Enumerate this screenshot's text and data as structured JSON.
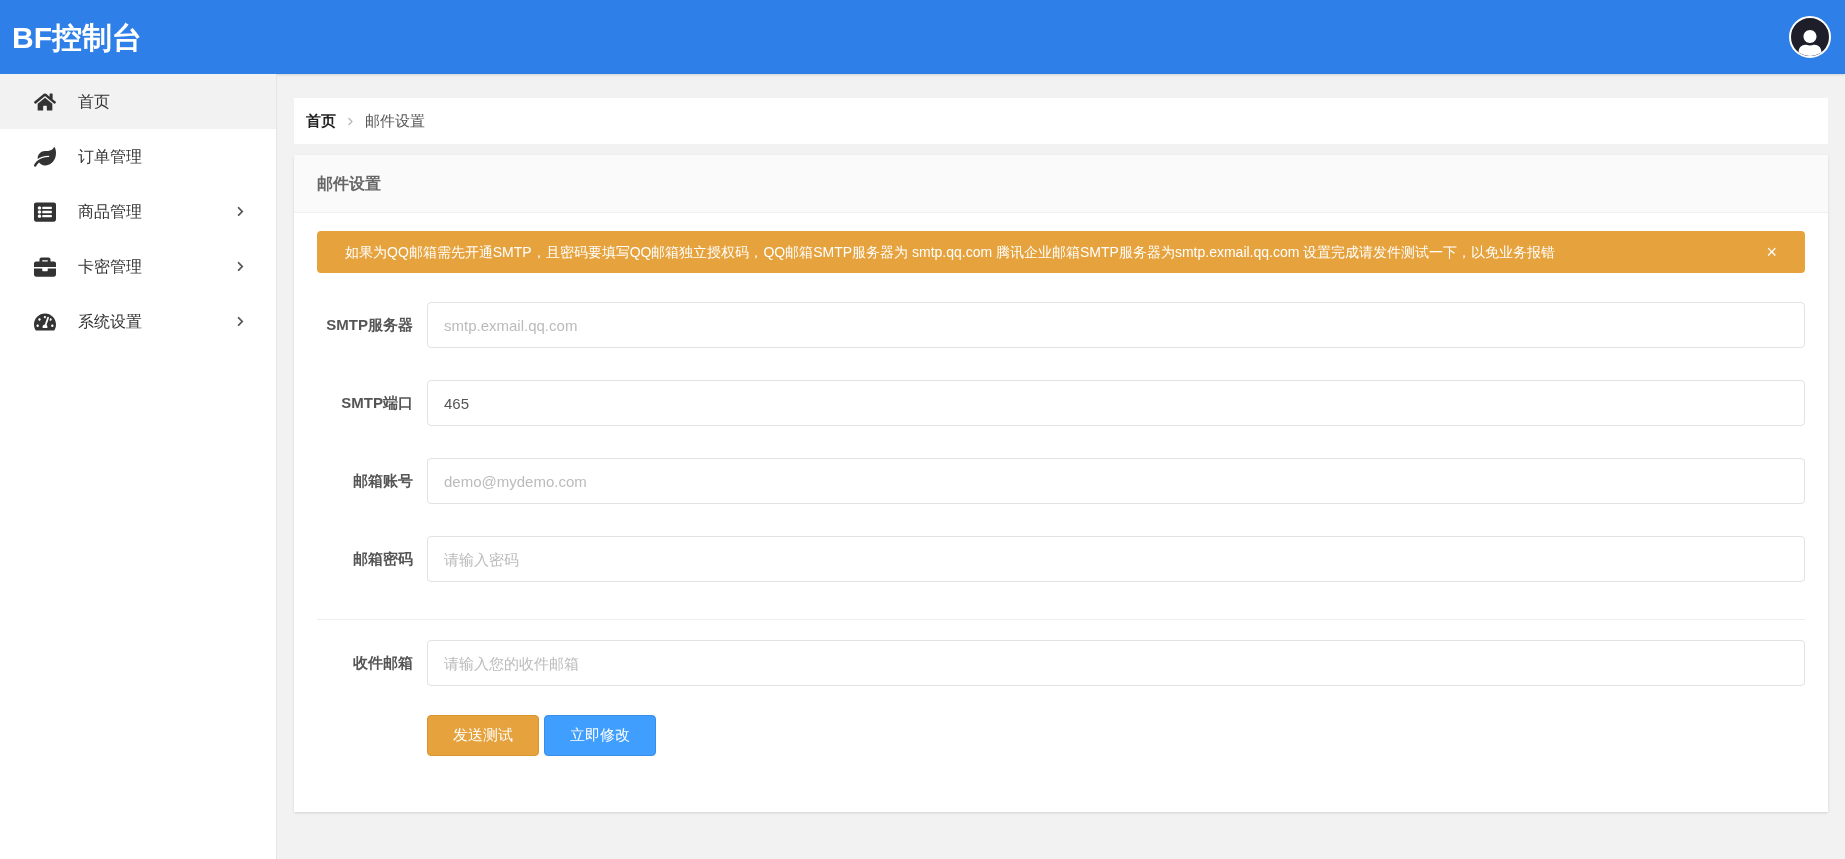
{
  "header": {
    "title": "BF控制台"
  },
  "sidebar": {
    "items": [
      {
        "label": "首页",
        "selected": true,
        "has_submenu": false
      },
      {
        "label": "订单管理",
        "selected": false,
        "has_submenu": false
      },
      {
        "label": "商品管理",
        "selected": false,
        "has_submenu": true
      },
      {
        "label": "卡密管理",
        "selected": false,
        "has_submenu": true
      },
      {
        "label": "系统设置",
        "selected": false,
        "has_submenu": true
      }
    ]
  },
  "breadcrumb": [
    "首页",
    "邮件设置"
  ],
  "card": {
    "title": "邮件设置",
    "alert": {
      "text": "如果为QQ邮箱需先开通SMTP，且密码要填写QQ邮箱独立授权码，QQ邮箱SMTP服务器为 smtp.qq.com 腾讯企业邮箱SMTP服务器为smtp.exmail.qq.com 设置完成请发件测试一下，以免业务报错",
      "close": "×"
    },
    "fields": [
      {
        "label": "SMTP服务器",
        "placeholder": "smtp.exmail.qq.com"
      },
      {
        "label": "SMTP端口",
        "value": "465"
      },
      {
        "label": "邮箱账号",
        "placeholder": "demo@mydemo.com"
      },
      {
        "label": "邮箱密码",
        "placeholder": "请输入密码"
      },
      {
        "label": "收件邮箱",
        "placeholder": "请输入您的收件邮箱",
        "divider_before": true
      }
    ],
    "buttons": [
      {
        "label": "发送测试",
        "kind": "warning"
      },
      {
        "label": "立即修改",
        "kind": "primary"
      }
    ]
  }
}
